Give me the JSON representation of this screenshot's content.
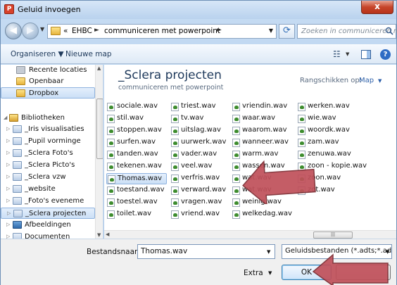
{
  "window": {
    "title": "Geluid invoegen",
    "title_icon_glyph": "P",
    "close_glyph": "x"
  },
  "address": {
    "overflow": "«",
    "crumbs": [
      "EHBC",
      "communiceren met powerpoint"
    ],
    "separator": "►"
  },
  "search": {
    "placeholder": "Zoeken in communiceren met ..."
  },
  "toolbar": {
    "organize_label": "Organiseren ▼",
    "new_folder_label": "Nieuwe map",
    "help_glyph": "?"
  },
  "navpane": {
    "items": [
      {
        "label": "Recente locaties",
        "icon": "recent-places-icon"
      },
      {
        "label": "Openbaar",
        "icon": "folder-icon"
      },
      {
        "label": "Dropbox",
        "icon": "dropbox-icon"
      },
      {
        "label": "Bibliotheken",
        "icon": "libraries-icon"
      },
      {
        "label": "_Iris visualisaties",
        "icon": "library-folder-icon"
      },
      {
        "label": "_Pupil vorminge",
        "icon": "library-folder-icon"
      },
      {
        "label": "_Sclera Foto's",
        "icon": "library-folder-icon"
      },
      {
        "label": "_Sclera Picto's",
        "icon": "library-folder-icon"
      },
      {
        "label": "_Sclera vzw",
        "icon": "library-folder-icon"
      },
      {
        "label": "_website",
        "icon": "library-folder-icon"
      },
      {
        "label": "_Foto's eveneme",
        "icon": "library-folder-icon"
      },
      {
        "label": "_Sclera projecten",
        "icon": "library-folder-icon"
      },
      {
        "label": "Afbeeldingen",
        "icon": "pictures-icon"
      },
      {
        "label": "Documenten",
        "icon": "library-folder-icon"
      }
    ]
  },
  "library": {
    "title": "_Sclera projecten",
    "subtitle": "communiceren met powerpoint",
    "arrange_label": "Rangschikken op:",
    "arrange_value": "Map"
  },
  "files": {
    "col1": [
      "sociale.wav",
      "stil.wav",
      "stoppen.wav",
      "surfen.wav",
      "tanden.wav",
      "tekenen.wav",
      "Thomas.wav",
      "toestand.wav",
      "toestel.wav",
      "toilet.wav"
    ],
    "col2": [
      "triest.wav",
      "tv.wav",
      "uitslag.wav",
      "uurwerk.wav",
      "vader.wav",
      "veel.wav",
      "verfris.wav",
      "verward.wav",
      "vragen.wav",
      "vriend.wav"
    ],
    "col3": [
      "vriendin.wav",
      "waar.wav",
      "waarom.wav",
      "wanneer.wav",
      "warm.wav",
      "wassen.wav",
      "wat.wav",
      "wat.wav",
      "weinig.wav",
      "welkedag.wav"
    ],
    "col4": [
      "werken.wav",
      "wie.wav",
      "woordk.wav",
      "zam.wav",
      "zenuwa.wav",
      "zoon - kopie.wav",
      "zoon.wav",
      "zot.wav"
    ],
    "selected": "Thomas.wav"
  },
  "bottom": {
    "filename_label": "Bestandsnaam:",
    "filename_value": "Thomas.wav",
    "filetype_value": "Geluidsbestanden (*.adts;*.adt;*",
    "extra_label": "Extra",
    "ok_label": "OK",
    "cancel_label": ""
  },
  "colors": {
    "accent": "#1e395b",
    "arrow_fill": "#c0505a",
    "selection": "#cbdff6"
  }
}
